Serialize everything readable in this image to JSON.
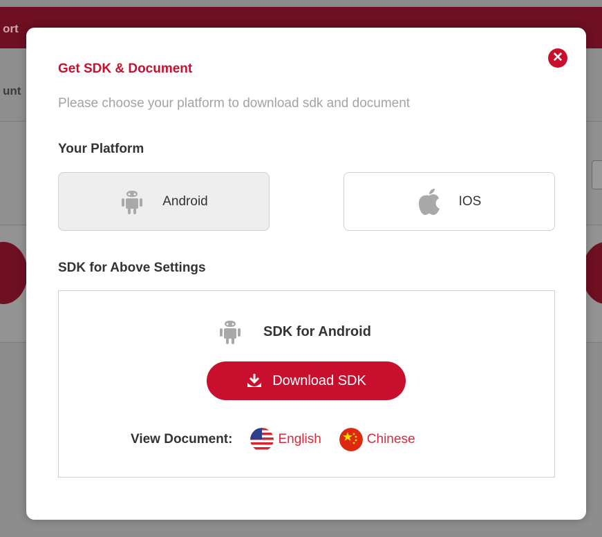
{
  "background": {
    "topbar_fragment": "ort",
    "band_fragment": "unt"
  },
  "modal": {
    "title": "Get SDK & Document",
    "subtitle": "Please choose your platform to download sdk and document",
    "close_icon": "close-icon",
    "platform_section_label": "Your Platform",
    "platforms": [
      {
        "label": "Android",
        "icon": "android-icon",
        "selected": true
      },
      {
        "label": "IOS",
        "icon": "apple-icon",
        "selected": false
      }
    ],
    "sdk_section_label": "SDK for Above Settings",
    "sdk_box": {
      "heading": "SDK for Android",
      "download_label": "Download SDK",
      "view_document_label": "View Document:",
      "doc_links": [
        {
          "label": "English",
          "icon": "us-flag-icon"
        },
        {
          "label": "Chinese",
          "icon": "china-flag-icon"
        }
      ]
    }
  },
  "colors": {
    "accent": "#c8102e",
    "link": "#d42a3a",
    "muted_text": "#a3a3a3",
    "icon_gray": "#a9a9a9"
  }
}
